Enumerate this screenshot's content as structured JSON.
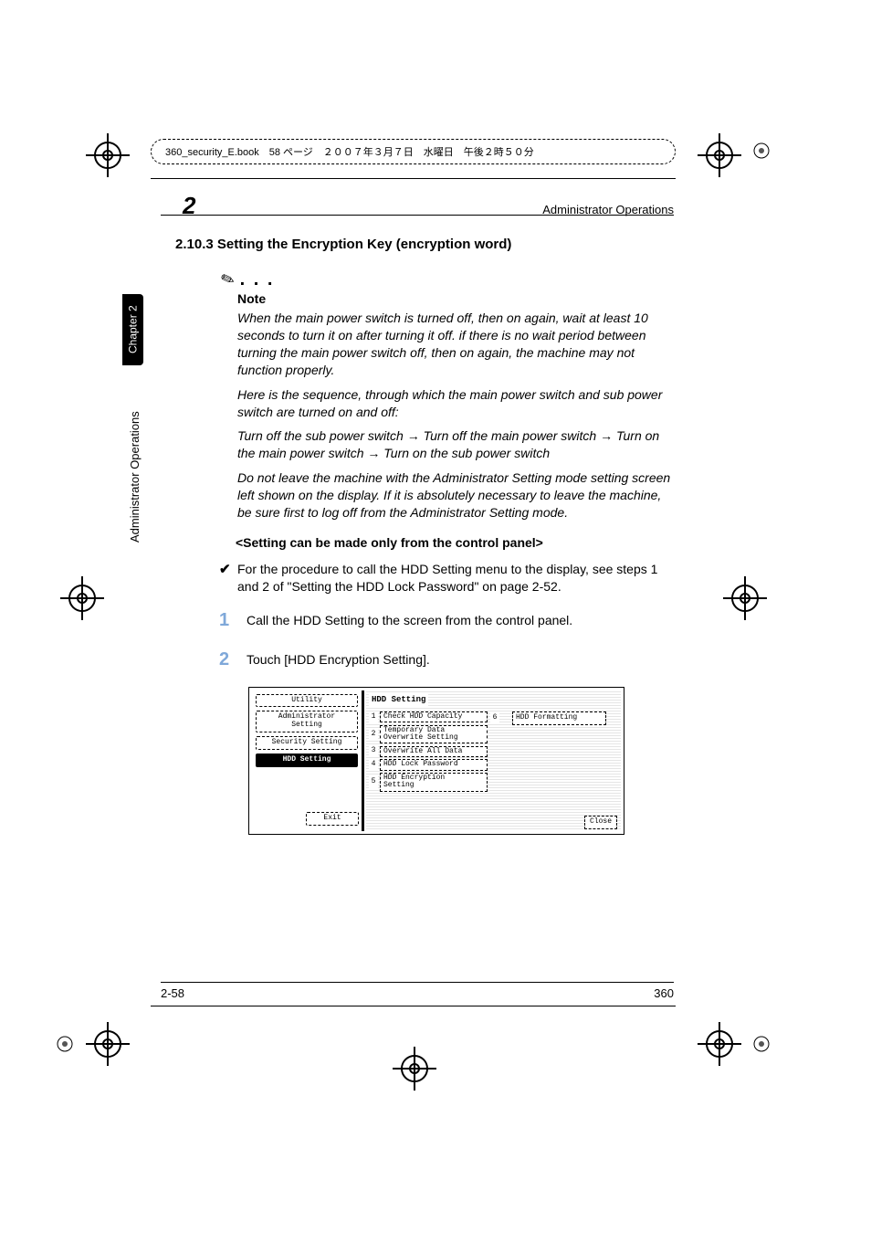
{
  "header_strip": "360_security_E.book　58 ページ　２００７年３月７日　水曜日　午後２時５０分",
  "running_head": {
    "chapnum": "2",
    "title": "Administrator Operations"
  },
  "side": {
    "chapter": "Chapter 2",
    "label": "Administrator Operations"
  },
  "section": {
    "title": "2.10.3  Setting the Encryption Key (encryption word)",
    "note_label": "Note",
    "note_p1": "When the main power switch is turned off, then on again, wait at least 10 seconds to turn it on after turning it off. if there is no wait period between turning the main power switch off, then on again, the machine may not function properly.",
    "note_p2": "Here is the sequence, through which the main power switch and sub power switch are turned on and off:",
    "note_p3_a": "Turn off the sub power switch ",
    "note_p3_b": " Turn off the main power switch ",
    "note_p3_c": " Turn on the main power switch ",
    "note_p3_d": " Turn on the sub power switch",
    "note_p4": "Do not leave the machine with the Administrator Setting mode setting screen left shown on the display. If it is absolutely necessary to leave the machine, be sure first to log off from the Administrator Setting mode.",
    "subhead": "<Setting can be made only from the control panel>",
    "check": "For the procedure to call the HDD Setting menu to the display, see steps 1 and 2 of \"Setting the HDD Lock Password\" on page 2-52.",
    "step1": "Call the HDD Setting to the screen from the control panel.",
    "step2": "Touch [HDD Encryption Setting]."
  },
  "shot": {
    "left": {
      "utility": "Utility",
      "admin": "Administrator\nSetting",
      "security": "Security Setting",
      "hdd": "HDD Setting",
      "exit": "Exit"
    },
    "right": {
      "title": "HDD Setting",
      "opts": [
        {
          "n": "1",
          "label": "Check HDD Capacity"
        },
        {
          "n": "2",
          "label": "Temporary Data\nOverwrite Setting"
        },
        {
          "n": "3",
          "label": "Overwrite All Data"
        },
        {
          "n": "4",
          "label": "HDD Lock Password"
        },
        {
          "n": "5",
          "label": "HDD Encryption\nSetting"
        }
      ],
      "opt6": {
        "n": "6",
        "label": "HDD Formatting"
      },
      "close": "Close"
    }
  },
  "footer": {
    "left": "2-58",
    "right": "360"
  }
}
